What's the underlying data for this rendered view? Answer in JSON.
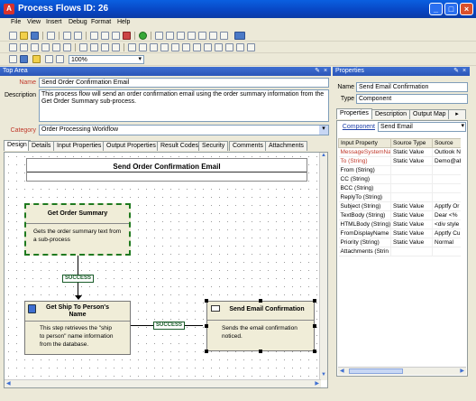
{
  "window": {
    "title": "Process Flows ID: 26",
    "minimize": "_",
    "maximize": "□",
    "close": "×"
  },
  "menu": [
    "File",
    "View",
    "Insert",
    "Debug",
    "Format",
    "Help"
  ],
  "toolbar": {
    "zoom": "100%"
  },
  "top_area": {
    "header": "Top Area",
    "name_label": "Name",
    "name_value": "Send Order Confirmation Email",
    "description_label": "Description",
    "description_value": "This process flow will send an order confirmation email using the order summary information from the Get Order Summary sub-process.",
    "category_label": "Category",
    "category_value": "Order Processing Workflow",
    "tabs": [
      "Design",
      "Details",
      "Input Properties",
      "Output Properties",
      "Result Codes",
      "Security",
      "Comments",
      "Attachments"
    ]
  },
  "canvas": {
    "title": "Send Order Confirmation Email",
    "nodes": [
      {
        "title": "Get Order Summary",
        "body": "Gets the order summary text from a sub-process"
      },
      {
        "title": "Get Ship To Person's Name",
        "body": "This step retrieves the \"ship to person\" name information from the database."
      },
      {
        "title": "Send Email Confirmation",
        "body": "Sends the email confirmation noticed."
      }
    ],
    "connector_label_1": "SUCCESS",
    "connector_label_2": "SUCCESS"
  },
  "properties": {
    "header": "Properties",
    "name_label": "Name",
    "name_value": "Send Email Confirmation",
    "type_label": "Type",
    "type_value": "Component",
    "tabs": [
      "Properties",
      "Description",
      "Output Map"
    ],
    "component_label": "Component",
    "component_value": "Send Email",
    "columns": [
      "Input Property",
      "Source Type",
      "Source"
    ],
    "rows": [
      [
        "MessageSystemNa",
        "Static Value",
        "Outlook N"
      ],
      [
        "To (String)",
        "Static Value",
        "Demo@ab"
      ],
      [
        "From (String)",
        "",
        ""
      ],
      [
        "CC (String)",
        "",
        ""
      ],
      [
        "BCC (String)",
        "",
        ""
      ],
      [
        "ReplyTo (String)",
        "",
        ""
      ],
      [
        "Subject (String)",
        "Static Value",
        "Apptfy Or"
      ],
      [
        "TextBody (String)",
        "Static Value",
        "Dear <%"
      ],
      [
        "HTMLBody (String)",
        "Static Value",
        "<div style"
      ],
      [
        "FromDisplayName (",
        "Static Value",
        "Apptfy Cu"
      ],
      [
        "Priority (String)",
        "Static Value",
        "Normal"
      ],
      [
        "Attachments (Strin",
        "",
        ""
      ]
    ],
    "red_rows": [
      0,
      1
    ],
    "selected_tab": "Properties"
  }
}
